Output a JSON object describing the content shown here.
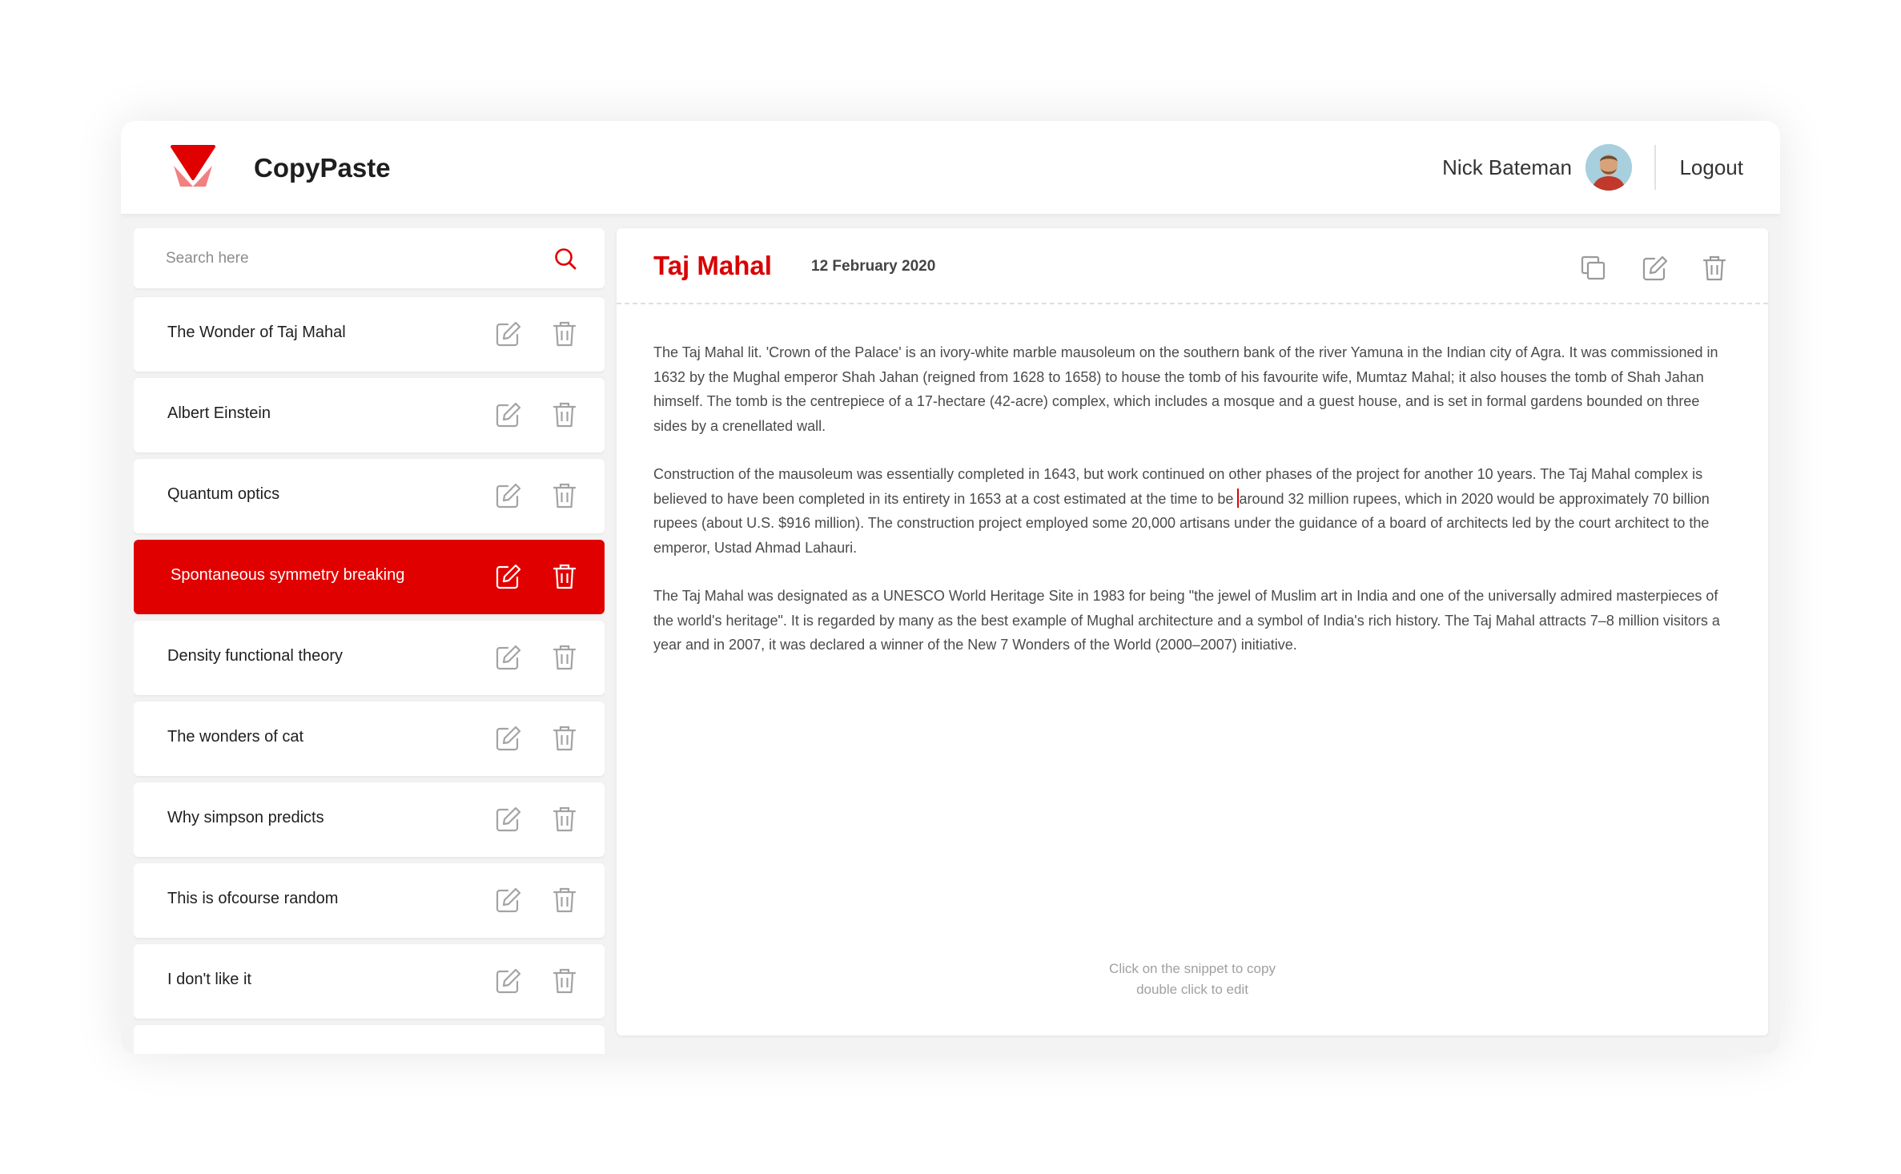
{
  "app": {
    "name": "CopyPaste",
    "accent": "#e00000"
  },
  "user": {
    "name": "Nick Bateman",
    "logout_label": "Logout"
  },
  "search": {
    "placeholder": "Search here"
  },
  "snippets": [
    {
      "title": "The Wonder of Taj Mahal",
      "active": false
    },
    {
      "title": "Albert Einstein",
      "active": false
    },
    {
      "title": "Quantum optics",
      "active": false
    },
    {
      "title": "Spontaneous symmetry breaking",
      "active": true
    },
    {
      "title": "Density functional theory",
      "active": false
    },
    {
      "title": "The wonders of cat",
      "active": false
    },
    {
      "title": "Why simpson predicts",
      "active": false
    },
    {
      "title": "This is ofcourse random",
      "active": false
    },
    {
      "title": "I don't like it",
      "active": false
    }
  ],
  "document": {
    "title": "Taj Mahal",
    "date": "12 February 2020",
    "paragraph_1": "The Taj Mahal lit. 'Crown of the Palace' is an ivory-white marble mausoleum on the southern bank of the river Yamuna in the Indian city of Agra. It was commissioned in 1632 by the Mughal emperor Shah Jahan (reigned from 1628 to 1658) to house the tomb of his favourite wife, Mumtaz Mahal; it also houses the tomb of Shah Jahan himself. The tomb is the centrepiece of a 17-hectare (42-acre) complex, which includes a mosque and a guest house, and is set in formal gardens bounded on three sides by a crenellated wall.",
    "paragraph_2_before_cursor": "Construction of the mausoleum was essentially completed in 1643, but work continued on other phases of the project for another 10 years. The Taj Mahal complex is believed to have been completed in its entirety in 1653 at a cost estimated at the time to be ",
    "paragraph_2_after_cursor": "around 32 million rupees, which in 2020 would be approximately 70 billion rupees (about U.S. $916 million). The construction project employed some 20,000 artisans under the guidance of a board of architects led by the court architect to the emperor, Ustad Ahmad Lahauri.",
    "paragraph_3": "The Taj Mahal was designated as a UNESCO World Heritage Site in 1983 for being \"the jewel of Muslim art in India and one of the universally admired masterpieces of the world's heritage\". It is regarded by many as the best example of Mughal architecture and a symbol of India's rich history. The Taj Mahal attracts 7–8 million visitors a year and in 2007, it was declared a winner of the New 7 Wonders of the World (2000–2007) initiative."
  },
  "hint": {
    "line_1": "Click on the snippet to copy",
    "line_2": "double click to edit"
  }
}
